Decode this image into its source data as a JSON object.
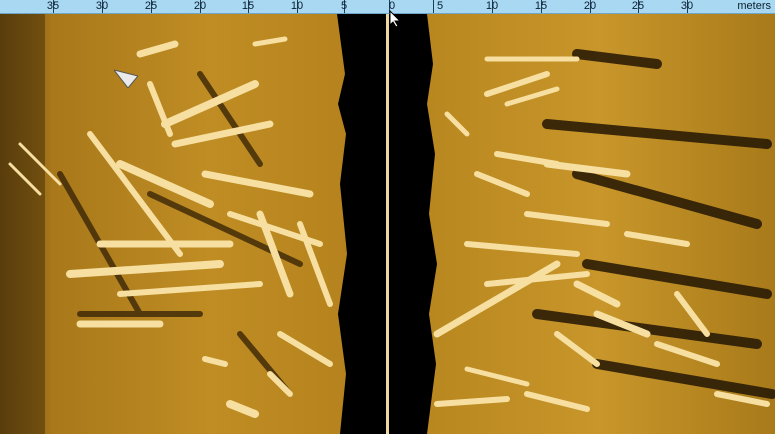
{
  "ruler": {
    "left_labels": [
      "35",
      "30",
      "25",
      "20",
      "15",
      "10",
      "5"
    ],
    "center_label": "0",
    "right_labels": [
      "5",
      "10",
      "15",
      "20",
      "25",
      "30"
    ],
    "unit": "meters"
  },
  "icons": {
    "cursor": "mouse-pointer-icon",
    "target_marker": "target-marker-icon"
  },
  "colors": {
    "ruler_bg": "#a9d8f2",
    "seabed": "#b8861f",
    "water_column": "#000000",
    "nadir_line": "#f1d7a0"
  }
}
